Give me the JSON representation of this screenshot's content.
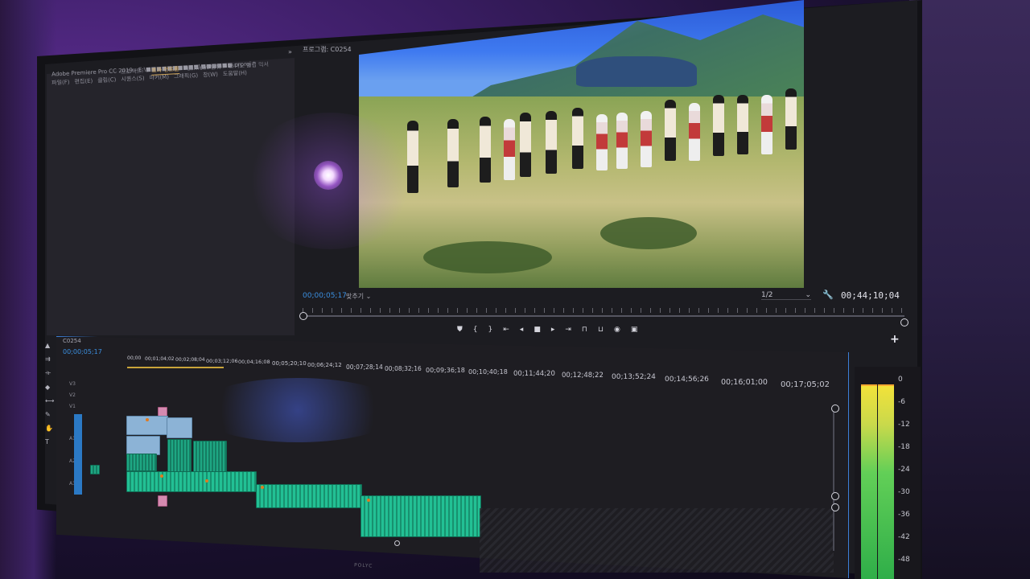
{
  "app": {
    "title": "Adobe Premiere Pro CC 2019 - E:\\■■■■■■■■■■\\■■■■■■.prproj *",
    "menu": [
      "파일(F)",
      "편집(E)",
      "클립(C)",
      "시퀀스(S)",
      "마커(M)",
      "그래픽(G)",
      "창(W)",
      "도움말(H)"
    ],
    "left_tabs": [
      "프로젝트:",
      "효과 컨트롤",
      "Lumetri 범위",
      "오디오 클립 믹서"
    ],
    "active_left_tab": "효과 컨트롤"
  },
  "program_monitor": {
    "label": "프로그램: C0254",
    "tabs_more": "»",
    "current_timecode": "00;00;05;17",
    "fit_label": "맞추기",
    "resolution": "1/2",
    "duration_timecode": "00;44;10;04",
    "controls": [
      "marker-icon",
      "in-point-icon",
      "out-point-icon",
      "go-to-in-icon",
      "step-back-icon",
      "stop-icon",
      "play-icon",
      "go-to-out-icon",
      "lift-icon",
      "extract-icon",
      "export-frame-icon",
      "comparison-icon"
    ],
    "add_button": "+"
  },
  "timeline": {
    "sequence_name": "C0254",
    "current_timecode": "00;00;05;17",
    "ruler": [
      "00;00",
      "00;01;04;02",
      "00;02;08;04",
      "00;03;12;06",
      "00;04;16;08",
      "00;05;20;10",
      "00;06;24;12",
      "00;07;28;14",
      "00;08;32;16",
      "00;09;36;18",
      "00;10;40;18",
      "00;11;44;20",
      "00;12;48;22",
      "00;13;52;24",
      "00;14;56;26",
      "00;16;01;00",
      "00;17;05;02"
    ],
    "tracks": [
      "V3",
      "V2",
      "V1",
      "A1",
      "A2",
      "A3"
    ]
  },
  "audio_meter": {
    "db_labels": [
      "0",
      "-6",
      "-12",
      "-18",
      "-24",
      "-30",
      "-36",
      "-42",
      "-48"
    ],
    "colors": {
      "low": "#2fae49",
      "mid": "#62cf57",
      "high": "#f2e23a",
      "peak": "#f6a830"
    }
  },
  "monitor_brand": "POLYC",
  "colors": {
    "timecode_blue": "#3b8fe0",
    "clip_video": "#8cb3d6",
    "clip_audio": "#1ea783",
    "selection_border": "#3c7fd8",
    "inout_bar": "#c9a43a"
  }
}
